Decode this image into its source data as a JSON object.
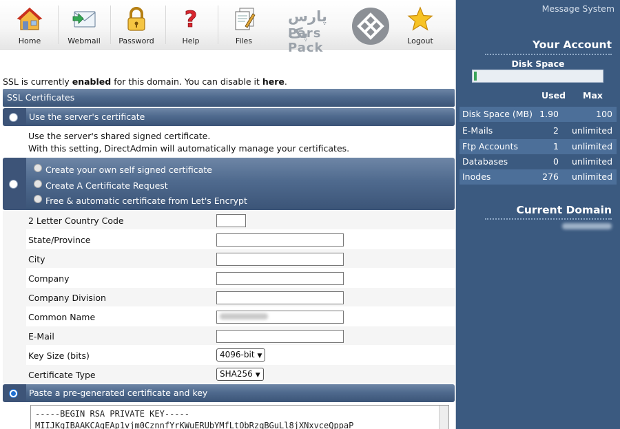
{
  "nav": {
    "items": [
      {
        "label": "Home",
        "icon": "house-icon"
      },
      {
        "label": "Webmail",
        "icon": "envelope-icon"
      },
      {
        "label": "Password",
        "icon": "lock-icon"
      },
      {
        "label": "Help",
        "icon": "question-icon"
      },
      {
        "label": "Files",
        "icon": "files-icon"
      },
      {
        "label": "Logout",
        "icon": "star-icon"
      }
    ],
    "logo_fa": "پارس پک",
    "logo_en": "Pars Pack"
  },
  "ssl_status": {
    "prefix": "SSL is currently",
    "state": "enabled",
    "middle": "for this domain. You can disable it",
    "link": "here",
    "suffix": "."
  },
  "section_title": "SSL Certificates",
  "option_server": {
    "label": "Use the server's certificate",
    "desc_line1": "Use the server's shared signed certificate.",
    "desc_line2": "With this setting, DirectAdmin will automatically manage your certificates."
  },
  "option_own": {
    "choices": [
      "Create your own self signed certificate",
      "Create A Certificate Request",
      "Free & automatic certificate from Let's Encrypt"
    ]
  },
  "form": {
    "country_label": "2 Letter Country Code",
    "country_value": "",
    "state_label": "State/Province",
    "state_value": "",
    "city_label": "City",
    "city_value": "",
    "company_label": "Company",
    "company_value": "",
    "division_label": "Company Division",
    "division_value": "",
    "common_name_label": "Common Name",
    "common_name_value": "",
    "email_label": "E-Mail",
    "email_value": "",
    "key_size_label": "Key Size (bits)",
    "key_size_value": "4096-bit",
    "cert_type_label": "Certificate Type",
    "cert_type_value": "SHA256"
  },
  "option_paste": {
    "label": "Paste a pre-generated certificate and key",
    "key_line1": "-----BEGIN RSA PRIVATE KEY-----",
    "key_line2": "MIIJKgIBAAKCAgEAp1vjm0CznnfYrKWuERUbYMfLtObRzqBGuLl8jXNxvceQppaP"
  },
  "side": {
    "message_system": "Message System",
    "your_account": "Your Account",
    "disk_space_title": "Disk Space",
    "disk_usage_fraction": 0.019,
    "col_used": "Used",
    "col_max": "Max",
    "stats": [
      {
        "name": "Disk Space (MB)",
        "used": "1.90",
        "max": "100"
      },
      {
        "name": "E-Mails",
        "used": "2",
        "max": "unlimited"
      },
      {
        "name": "Ftp Accounts",
        "used": "1",
        "max": "unlimited"
      },
      {
        "name": "Databases",
        "used": "0",
        "max": "unlimited"
      },
      {
        "name": "Inodes",
        "used": "276",
        "max": "unlimited"
      }
    ],
    "current_domain": "Current Domain"
  }
}
